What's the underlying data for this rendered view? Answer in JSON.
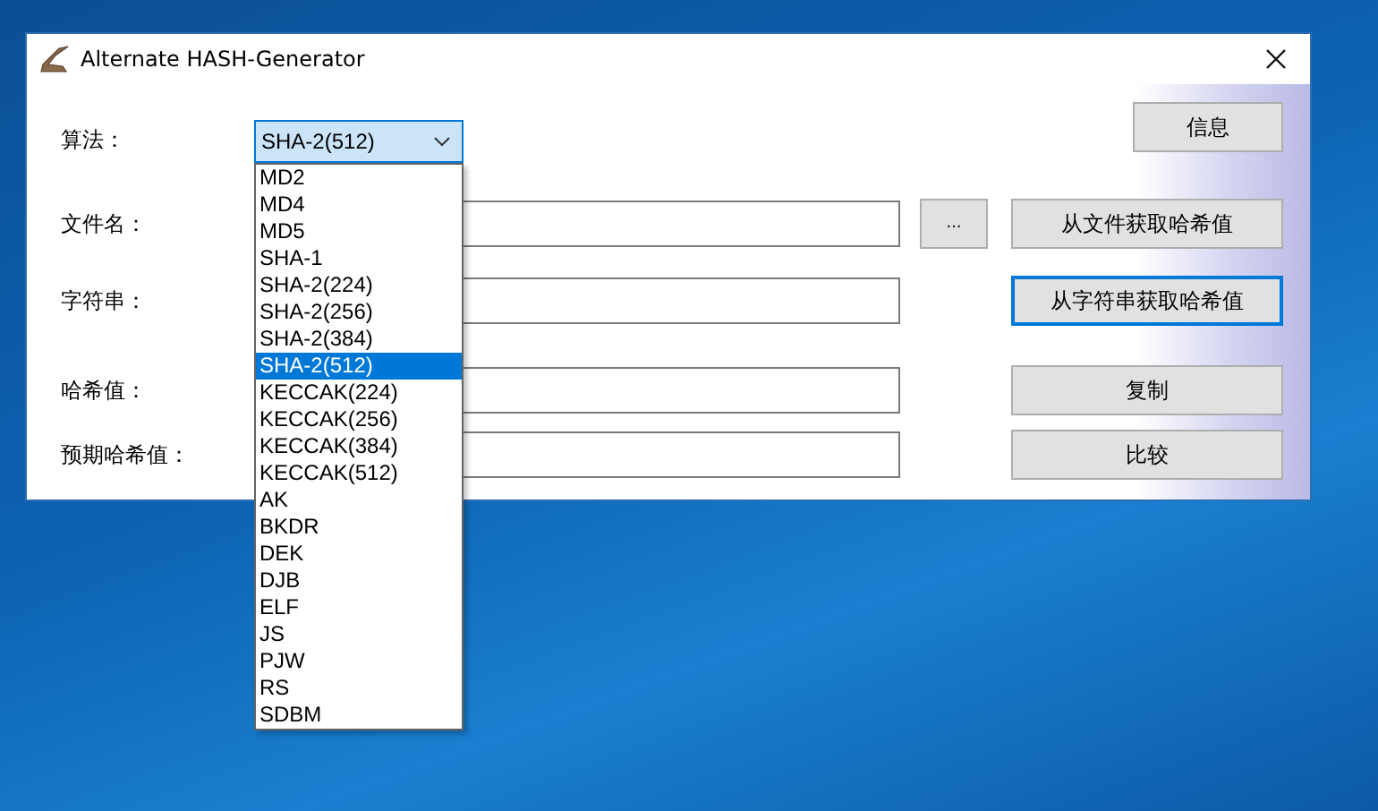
{
  "window": {
    "title": "Alternate HASH-Generator"
  },
  "algorithm": {
    "label": "算法：",
    "value": "SHA-2(512)",
    "expanded": true,
    "options": [
      {
        "label": "MD2",
        "selected": false
      },
      {
        "label": "MD4",
        "selected": false
      },
      {
        "label": "MD5",
        "selected": false
      },
      {
        "label": "SHA-1",
        "selected": false
      },
      {
        "label": "SHA-2(224)",
        "selected": false
      },
      {
        "label": "SHA-2(256)",
        "selected": false
      },
      {
        "label": "SHA-2(384)",
        "selected": false
      },
      {
        "label": "SHA-2(512)",
        "selected": true
      },
      {
        "label": "KECCAK(224)",
        "selected": false
      },
      {
        "label": "KECCAK(256)",
        "selected": false
      },
      {
        "label": "KECCAK(384)",
        "selected": false
      },
      {
        "label": "KECCAK(512)",
        "selected": false
      },
      {
        "label": "AK",
        "selected": false
      },
      {
        "label": "BKDR",
        "selected": false
      },
      {
        "label": "DEK",
        "selected": false
      },
      {
        "label": "DJB",
        "selected": false
      },
      {
        "label": "ELF",
        "selected": false
      },
      {
        "label": "JS",
        "selected": false
      },
      {
        "label": "PJW",
        "selected": false
      },
      {
        "label": "RS",
        "selected": false
      },
      {
        "label": "SDBM",
        "selected": false
      }
    ]
  },
  "info_button": "信息",
  "file": {
    "label": "文件名：",
    "browse_button": "...",
    "action_button": "从文件获取哈希值",
    "focused": false
  },
  "string": {
    "label": "字符串：",
    "action_button": "从字符串获取哈希值",
    "focused": true
  },
  "hash": {
    "label": "哈希值：",
    "action_button": "复制",
    "focused": false
  },
  "expected_hash": {
    "label": "预期哈希值：",
    "action_button": "比较",
    "focused": false
  }
}
